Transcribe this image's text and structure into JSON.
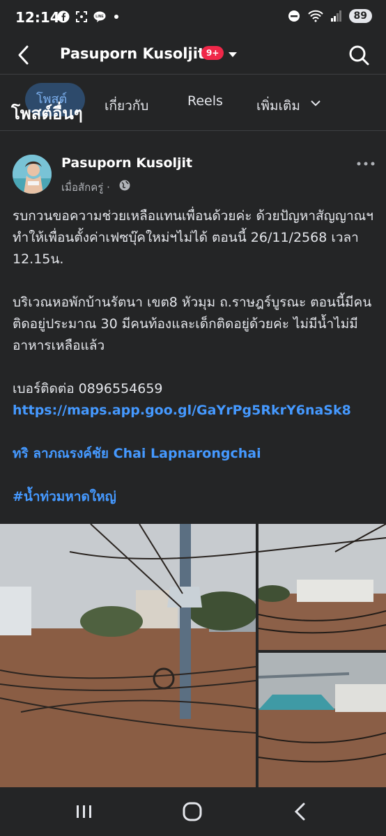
{
  "status": {
    "time": "12:14",
    "battery": "89"
  },
  "topbar": {
    "title": "Pasuporn Kusoljit",
    "badge": "9+"
  },
  "tabs": {
    "posts_label": "โพสต์",
    "posts_overlay_label": "โพสต์อื่นๆ",
    "about_label": "เกี่ยวกับ",
    "reels_label": "Reels",
    "more_label": "เพิ่มเติม"
  },
  "post": {
    "author": "Pasuporn Kusoljit",
    "time": "เมื่อสักครู่ ·",
    "paragraph1": "รบกวนขอความช่วยเหลือแทนเพื่อนด้วยค่ะ ด้วยปัญหาสัญญาณฯ ทำให้เพื่อนตั้งค่าเฟซบุ๊คใหม่ฯไม่ได้ ตอนนี้ 26/11/2568 เวลา 12.15น.",
    "paragraph2": "บริเวณหอพักบ้านรัตนา เขต8 หัวมุม ถ.ราษฎร์บูรณะ ตอนนี้มีคนติดอยู่ประมาณ 30 มีคนท้องและเด็กติดอยู่ด้วยค่ะ ไม่มีน้ำไม่มีอาหารเหลือแล้ว",
    "phone_line": "เบอร์ติดต่อ 0896554659",
    "maps_link": "https://maps.app.goo.gl/GaYrPg5RkrY6naSk8",
    "mention": "ทริ ลาภณรงค์ชัย  Chai Lapnarongchai",
    "hashtag": "#น้ำท่วมหาดใหญ่"
  },
  "icons": {
    "back": "back-arrow-icon",
    "search": "search-icon",
    "menu": "more-dots-icon",
    "globe": "globe-icon"
  },
  "colors": {
    "background": "#242526",
    "link": "#4599ff",
    "badge": "#f02849",
    "active_tab": "#2d4a6b"
  }
}
